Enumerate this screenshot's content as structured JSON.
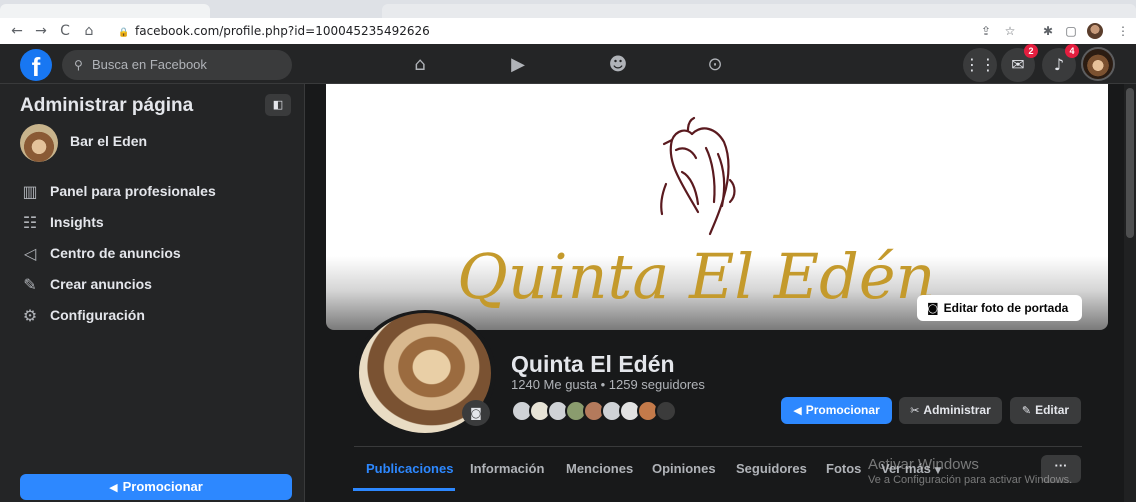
{
  "browser": {
    "url": "facebook.com/profile.php?id=100045235492626",
    "nav": {
      "back_icon": "←",
      "forward_icon": "→",
      "reload_icon": "C",
      "home_icon": "⌂"
    },
    "extensions": [
      "share-icon",
      "star-icon",
      "puzzle-icon",
      "sidebar-icon",
      "profile-icon",
      "menu-icon"
    ]
  },
  "topbar": {
    "logo": "f",
    "search_placeholder": "Busca en Facebook",
    "messenger_badge": "2",
    "notifications_badge": "4"
  },
  "sidebar": {
    "title": "Administrar página",
    "page_name": "Bar el Eden",
    "items": [
      {
        "label": "Panel para profesionales",
        "icon": "dashboard-icon"
      },
      {
        "label": "Insights",
        "icon": "insights-icon"
      },
      {
        "label": "Centro de anuncios",
        "icon": "megaphone-icon"
      },
      {
        "label": "Crear anuncios",
        "icon": "pencil-icon"
      },
      {
        "label": "Configuración",
        "icon": "gear-icon"
      }
    ],
    "promote_label": "Promocionar"
  },
  "cover": {
    "text": "Quinta El Edén",
    "edit_label": "Editar foto de portada"
  },
  "profile": {
    "name": "Quinta El Edén",
    "stats": "1240 Me gusta • 1259 seguidores",
    "buttons": {
      "promote": "Promocionar",
      "manage": "Administrar",
      "edit": "Editar"
    }
  },
  "tabs": [
    "Publicaciones",
    "Información",
    "Menciones",
    "Opiniones",
    "Seguidores",
    "Fotos",
    "Ver más"
  ],
  "more_button": "···",
  "watermark": {
    "line1": "Activar Windows",
    "line2": "Ve a Configuración para activar Windows."
  },
  "colors": {
    "accent": "#2d88ff",
    "cover_text": "#c49a2c",
    "horse": "#5a1a1f"
  }
}
